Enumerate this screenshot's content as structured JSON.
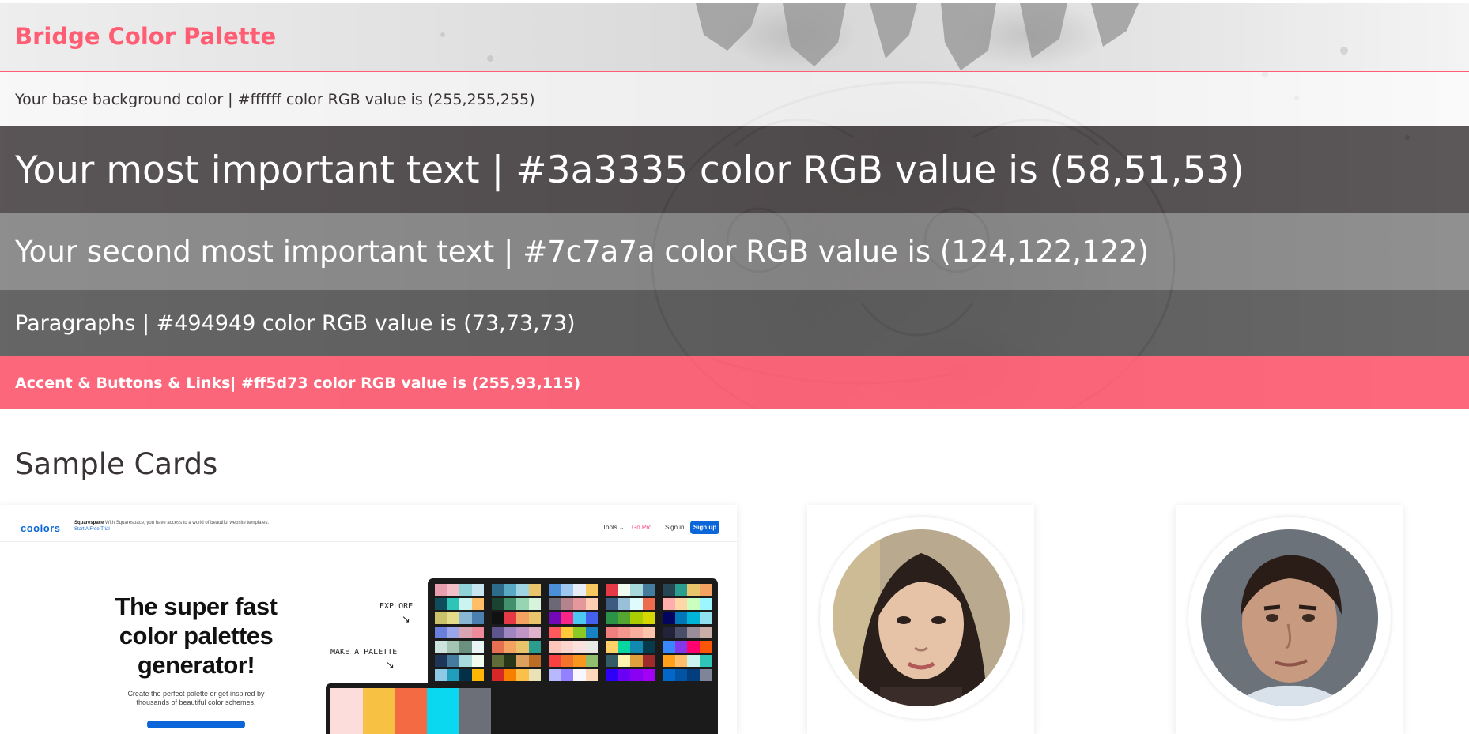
{
  "header": {
    "title": "Bridge Color Palette"
  },
  "bands": [
    {
      "label": "Your base background color | #ffffff color RGB value is (255,255,255)"
    },
    {
      "label": "Your most important text | #3a3335 color RGB value is (58,51,53)"
    },
    {
      "label": "Your second most important text | #7c7a7a color RGB value is (124,122,122)"
    },
    {
      "label": "Paragraphs | #494949 color RGB value is (73,73,73)"
    },
    {
      "label": "Accent & Buttons & Links| #ff5d73 color RGB value is (255,93,115)"
    }
  ],
  "colors": {
    "base": "#ffffff",
    "important_text": "#3a3335",
    "second_text": "#7c7a7a",
    "paragraphs": "#494949",
    "accent": "#ff5d73"
  },
  "section": {
    "title": "Sample Cards"
  },
  "sample_screenshot": {
    "logo": "coolors",
    "ad_brand": "Squarespace",
    "ad_text": "With Squarespace, you have access to a world of beautiful website templates.",
    "ad_link": "Start A Free Trial",
    "nav_tools": "Tools",
    "nav_gopro": "Go Pro",
    "nav_signin": "Sign in",
    "nav_signup": "Sign up",
    "headline": "The super fast color palettes generator!",
    "subtext": "Create the perfect palette or get inspired by thousands of beautiful color schemes.",
    "explore_label": "EXPLORE",
    "make_label": "MAKE A PALETTE"
  },
  "profiles": [
    {
      "icon": "woman-avatar"
    },
    {
      "icon": "man-avatar"
    }
  ]
}
